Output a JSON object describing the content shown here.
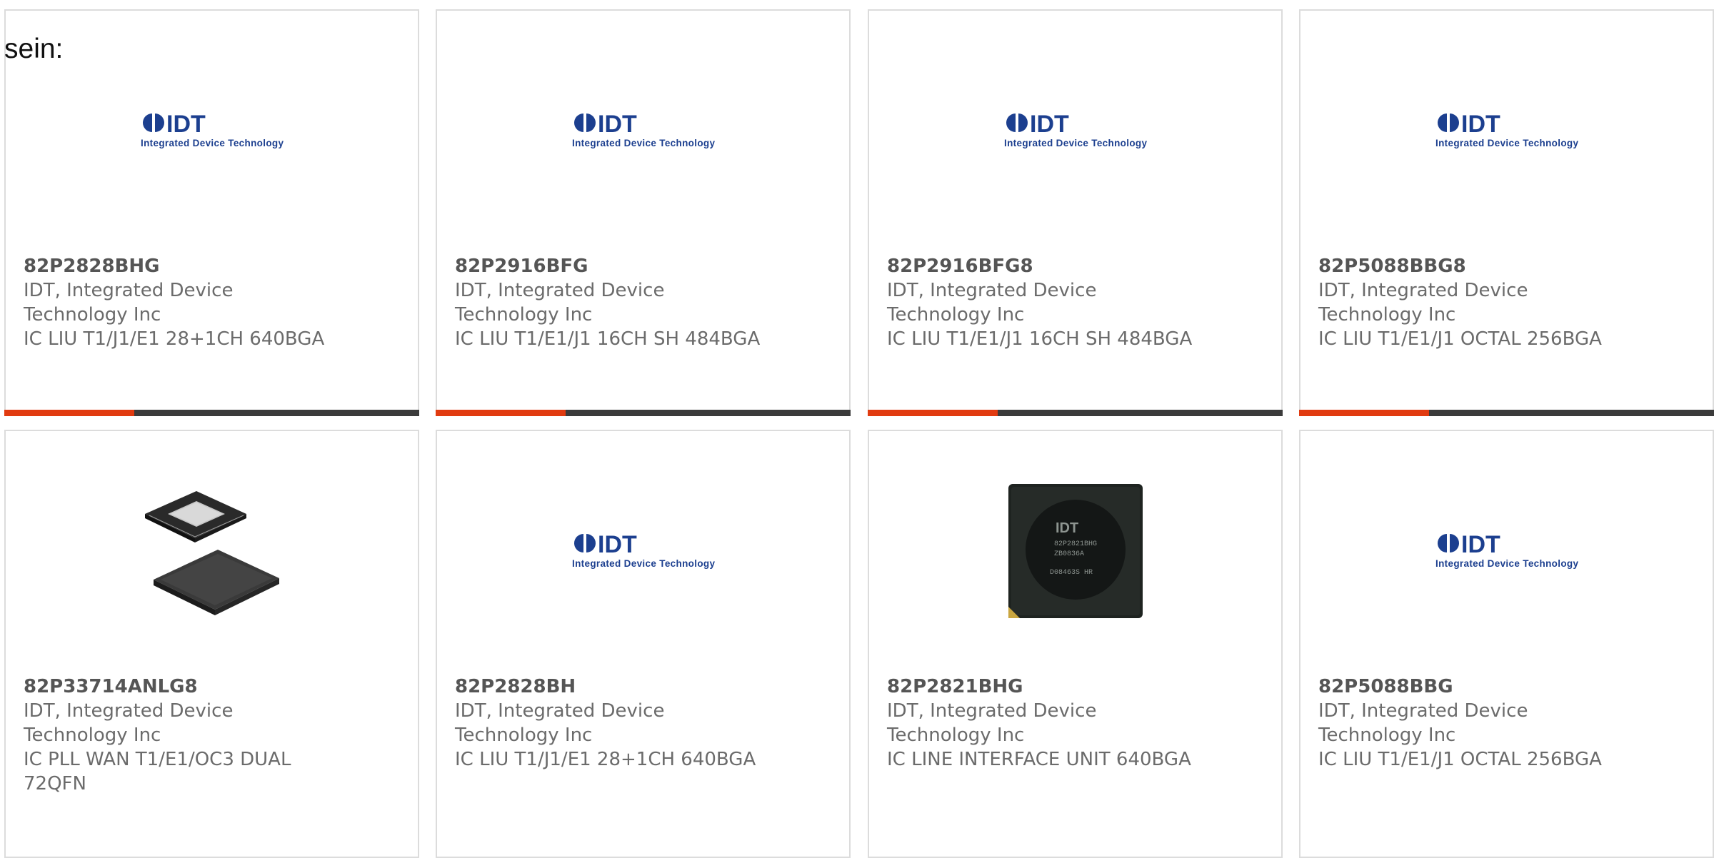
{
  "intro_text": "sein:",
  "logo": {
    "mark": "IDT",
    "tagline": "Integrated Device Technology"
  },
  "cards": [
    {
      "part_number": "82P2828BHG",
      "manufacturer_line1": "IDT, Integrated Device",
      "manufacturer_line2": "Technology Inc",
      "description": "IC LIU T1/J1/E1 28+1CH 640BGA",
      "image": "idt-logo-icon"
    },
    {
      "part_number": "82P2916BFG",
      "manufacturer_line1": "IDT, Integrated Device",
      "manufacturer_line2": "Technology Inc",
      "description": "IC LIU T1/E1/J1 16CH SH 484BGA",
      "image": "idt-logo-icon"
    },
    {
      "part_number": "82P2916BFG8",
      "manufacturer_line1": "IDT, Integrated Device",
      "manufacturer_line2": "Technology Inc",
      "description": "IC LIU T1/E1/J1 16CH SH 484BGA",
      "image": "idt-logo-icon"
    },
    {
      "part_number": "82P5088BBG8",
      "manufacturer_line1": "IDT, Integrated Device",
      "manufacturer_line2": "Technology Inc",
      "description": "IC LIU T1/E1/J1 OCTAL 256BGA",
      "image": "idt-logo-icon"
    },
    {
      "part_number": "82P33714ANLG8",
      "manufacturer_line1": "IDT, Integrated Device",
      "manufacturer_line2": "Technology Inc",
      "description": "IC PLL WAN T1/E1/OC3 DUAL 72QFN",
      "image": "qfn-chip-icon"
    },
    {
      "part_number": "82P2828BH",
      "manufacturer_line1": "IDT, Integrated Device",
      "manufacturer_line2": "Technology Inc",
      "description": "IC LIU T1/J1/E1 28+1CH 640BGA",
      "image": "idt-logo-icon"
    },
    {
      "part_number": "82P2821BHG",
      "manufacturer_line1": "IDT, Integrated Device",
      "manufacturer_line2": "Technology Inc",
      "description": "IC LINE INTERFACE UNIT 640BGA",
      "image": "bga-chip-icon",
      "chip_marking": [
        "IDT",
        "82P2821BHG",
        "ZB0836A",
        "D08463S HR"
      ]
    },
    {
      "part_number": "82P5088BBG",
      "manufacturer_line1": "IDT, Integrated Device",
      "manufacturer_line2": "Technology Inc",
      "description": "IC LIU T1/E1/J1 OCTAL 256BGA",
      "image": "idt-logo-icon"
    }
  ],
  "colors": {
    "accent": "#e13b10",
    "bar": "#3b3b3b",
    "border": "#dcdcdc",
    "text": "#6b6b6b",
    "logo_blue": "#1c3f8f"
  }
}
